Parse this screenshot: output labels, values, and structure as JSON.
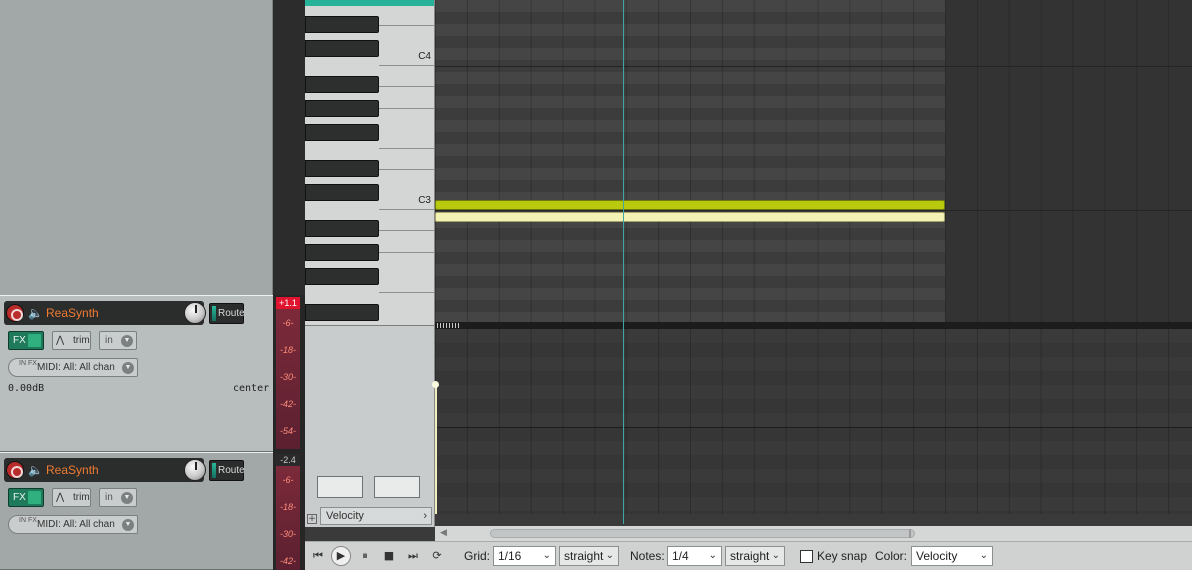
{
  "tracks": [
    {
      "name": "ReaSynth",
      "route_label": "Route",
      "fx_label": "FX",
      "trim_label": "trim",
      "input_label": "in",
      "midi_input": "MIDI: All: All chan",
      "volume": "0.00dB",
      "pan": "center",
      "meter_peak": "+1.1",
      "meter_ticks": [
        "-6-",
        "-18-",
        "-30-",
        "-42-",
        "-54-"
      ],
      "meter_ticks_extra": [
        "-18-",
        "-30-",
        "-42-",
        "-54-"
      ]
    },
    {
      "name": "ReaSynth",
      "route_label": "Route",
      "fx_label": "FX",
      "trim_label": "trim",
      "input_label": "in",
      "midi_input": "MIDI: All: All chan",
      "meter_peak": "-2.4",
      "meter_ticks": [
        "-6-",
        "-18-",
        "-30-",
        "-42-"
      ]
    }
  ],
  "infx_label": "IN FX",
  "piano": {
    "c4_label": "C4",
    "c3_label": "C3"
  },
  "velocity_lane": {
    "label": "Velocity",
    "add_symbol": "+"
  },
  "toolbar": {
    "grid_label": "Grid:",
    "grid_value": "1/16",
    "grid_mode": "straight",
    "notes_label": "Notes:",
    "notes_value": "1/4",
    "notes_mode": "straight",
    "keysnap_label": "Key snap",
    "color_label": "Color:",
    "color_value": "Velocity"
  },
  "icons": {
    "rewind": "rewind-icon",
    "play": "play-icon",
    "pause": "pause-icon",
    "stop": "stop-icon",
    "forward": "forward-icon",
    "repeat": "repeat-icon"
  },
  "colors": {
    "track_name": "#f07a30",
    "note_selected": "#b9c90d",
    "note_plain": "#f3f2b5",
    "playcursor": "#3ca7a7",
    "fx_button": "#1f7a5c",
    "keyboard_top": "#27b29a"
  }
}
